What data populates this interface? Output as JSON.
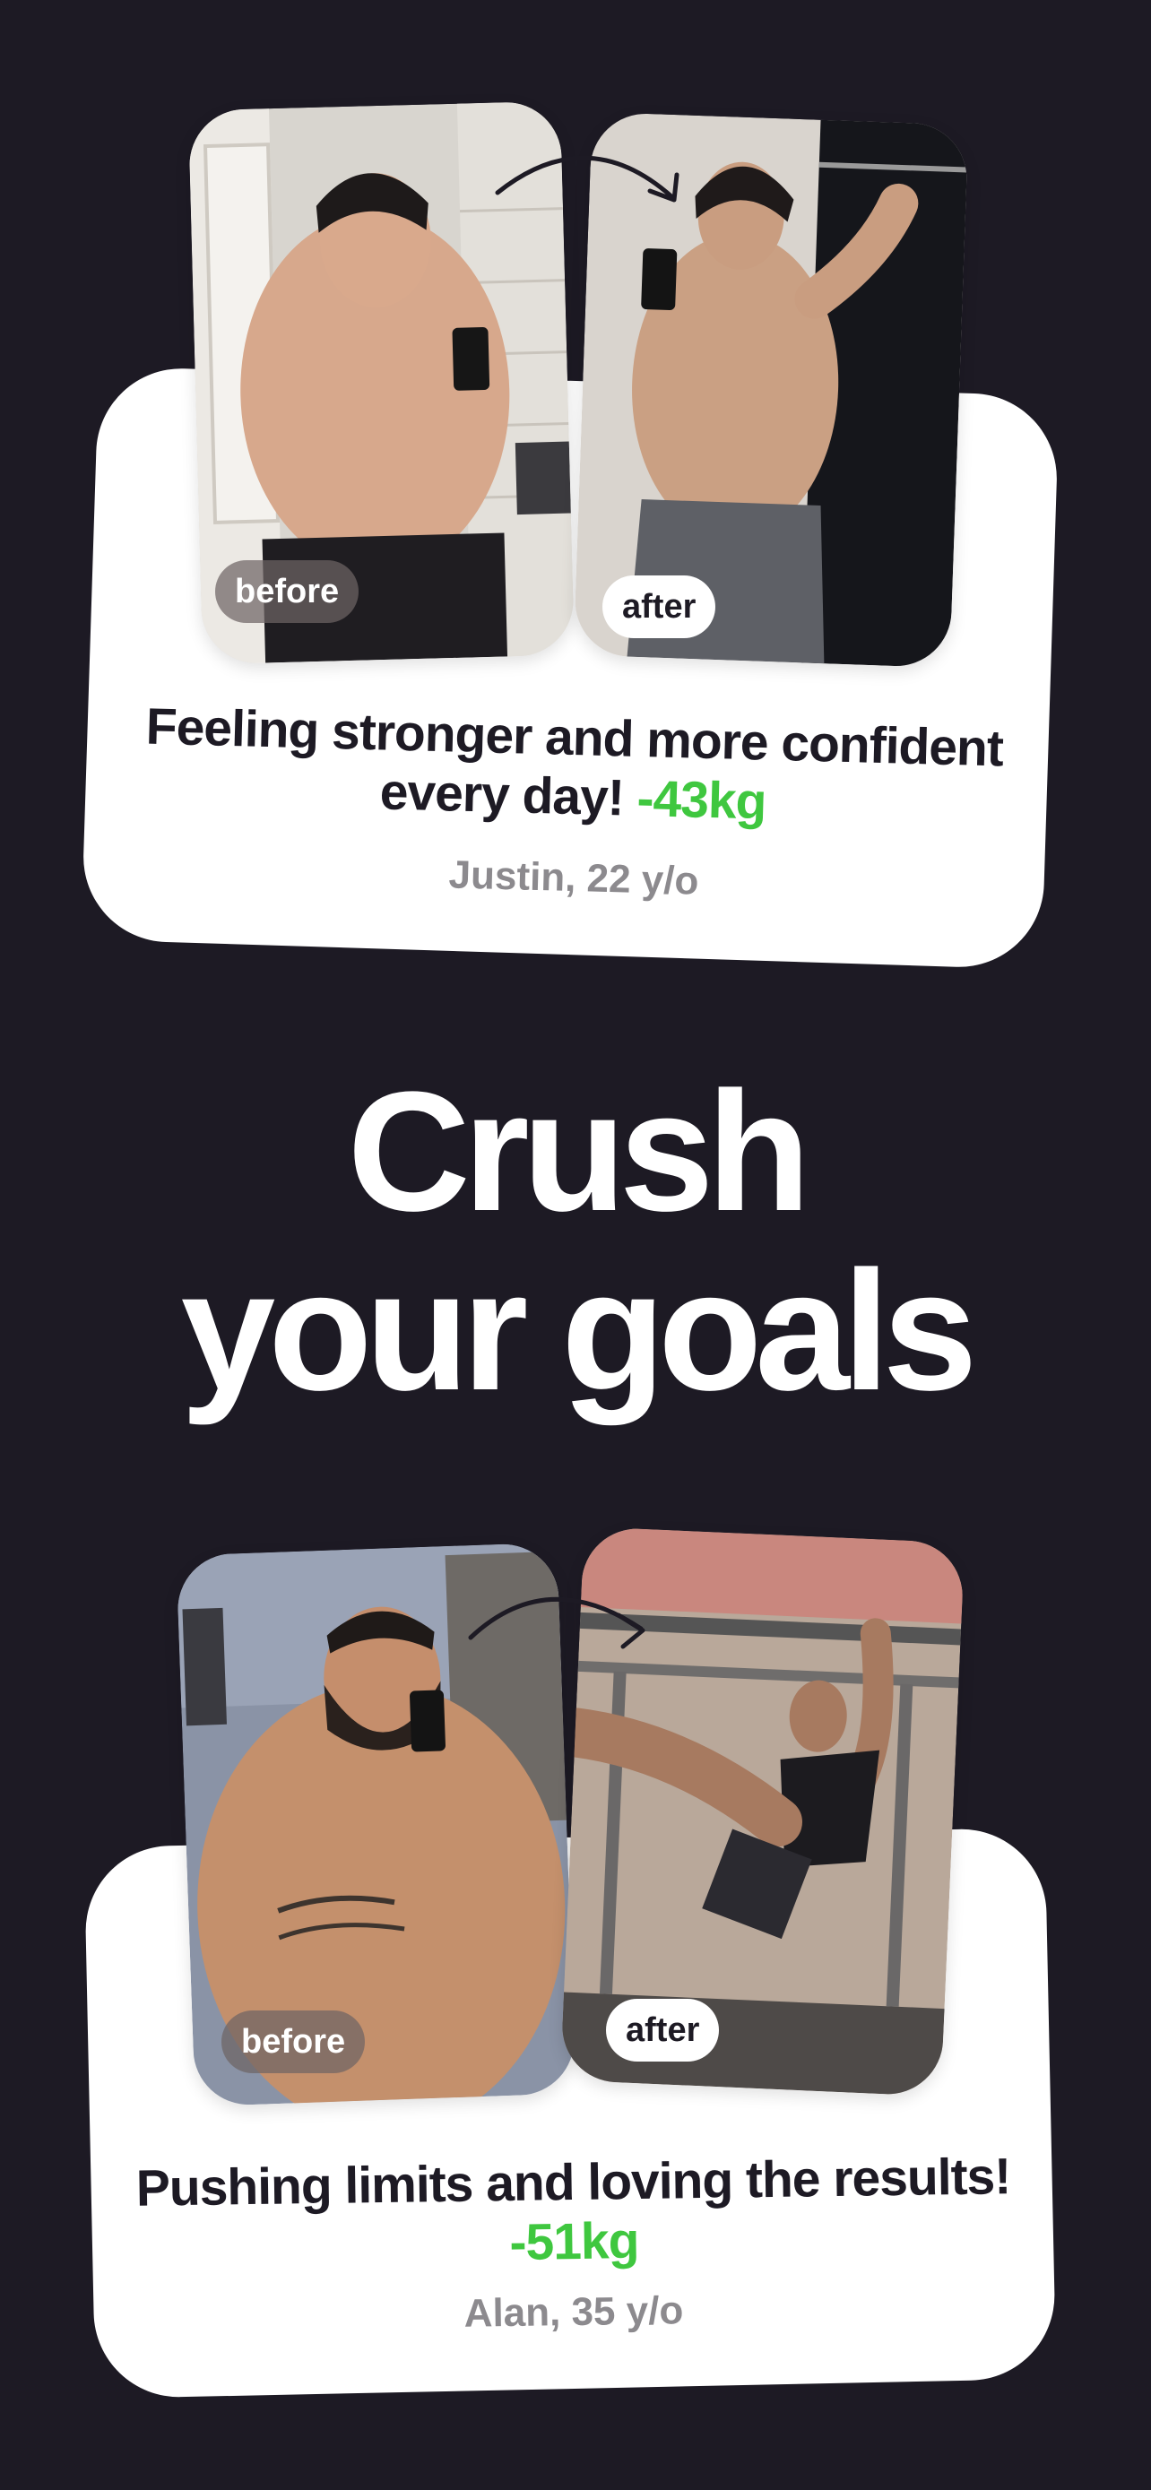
{
  "headline": {
    "line1": "Crush",
    "line2": "your goals"
  },
  "testimonials": [
    {
      "before_label": "before",
      "after_label": "after",
      "quote": "Feeling stronger and more confident every day!",
      "loss": "-43kg",
      "author": "Justin, 22 y/o"
    },
    {
      "before_label": "before",
      "after_label": "after",
      "quote": "Pushing limits and loving the results!",
      "loss": "-51kg",
      "author": "Alan, 35 y/o"
    }
  ],
  "colors": {
    "background": "#1d1a24",
    "card": "#ffffff",
    "accent_green": "#3fc73f",
    "muted_text": "#8c8a8e"
  }
}
